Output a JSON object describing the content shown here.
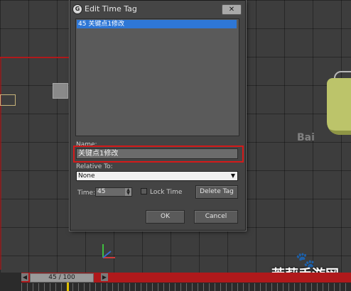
{
  "dialog": {
    "title": "Edit Time Tag",
    "close_label": "✕",
    "tags": [
      "45 关键点1修改"
    ],
    "name_label": "Name:",
    "name_value": "关键点1修改",
    "relative_label": "Relative To:",
    "relative_value": "None",
    "time_label": "Time:",
    "time_value": "45",
    "lock_label": "Lock Time",
    "lock_checked": false,
    "delete_label": "Delete Tag",
    "ok_label": "OK",
    "cancel_label": "Cancel"
  },
  "timeline": {
    "slider_label": "45 / 100",
    "prev_icon": "◀",
    "next_icon": "▶"
  },
  "watermark": {
    "text": "茉莉手游网",
    "baidu": "Bai"
  },
  "colors": {
    "highlight": "#d41a1a",
    "selection": "#2e77d6",
    "timeline_red": "#b0191b"
  }
}
